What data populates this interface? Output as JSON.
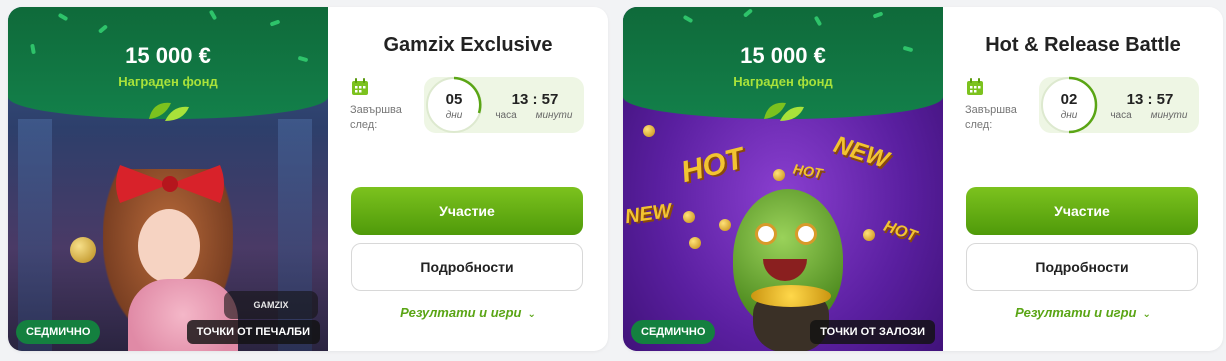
{
  "cards": [
    {
      "prize_amount": "15 000 €",
      "prize_label": "Награден фонд",
      "badge_left": "СЕДМИЧНО",
      "badge_right": "ТОЧКИ ОТ ПЕЧАЛБИ",
      "provider_logo": "GAMZIX",
      "title": "Gamzix Exclusive",
      "ends_label": "Завършва след:",
      "days": "05",
      "days_label": "дни",
      "time": "13 : 57",
      "hours_label": "часа",
      "minutes_label": "минути",
      "join_label": "Участие",
      "details_label": "Подробности",
      "results_label": "Резултати и игри"
    },
    {
      "prize_amount": "15 000 €",
      "prize_label": "Награден фонд",
      "badge_left": "СЕДМИЧНО",
      "badge_right": "ТОЧКИ ОТ ЗАЛОЗИ",
      "title": "Hot & Release Battle",
      "ends_label": "Завършва след:",
      "days": "02",
      "days_label": "дни",
      "time": "13 : 57",
      "hours_label": "часа",
      "minutes_label": "минути",
      "join_label": "Участие",
      "details_label": "Подробности",
      "results_label": "Резултати и игри",
      "art_words": [
        "HOT",
        "NEW",
        "HOT",
        "NEW",
        "HOT"
      ]
    }
  ],
  "colors": {
    "accent_green": "#5aa515",
    "dark_green": "#14803f",
    "button_green": "#6bb516"
  },
  "icons": [
    "calendar-icon",
    "leaf-icon",
    "chevron-down-icon"
  ]
}
